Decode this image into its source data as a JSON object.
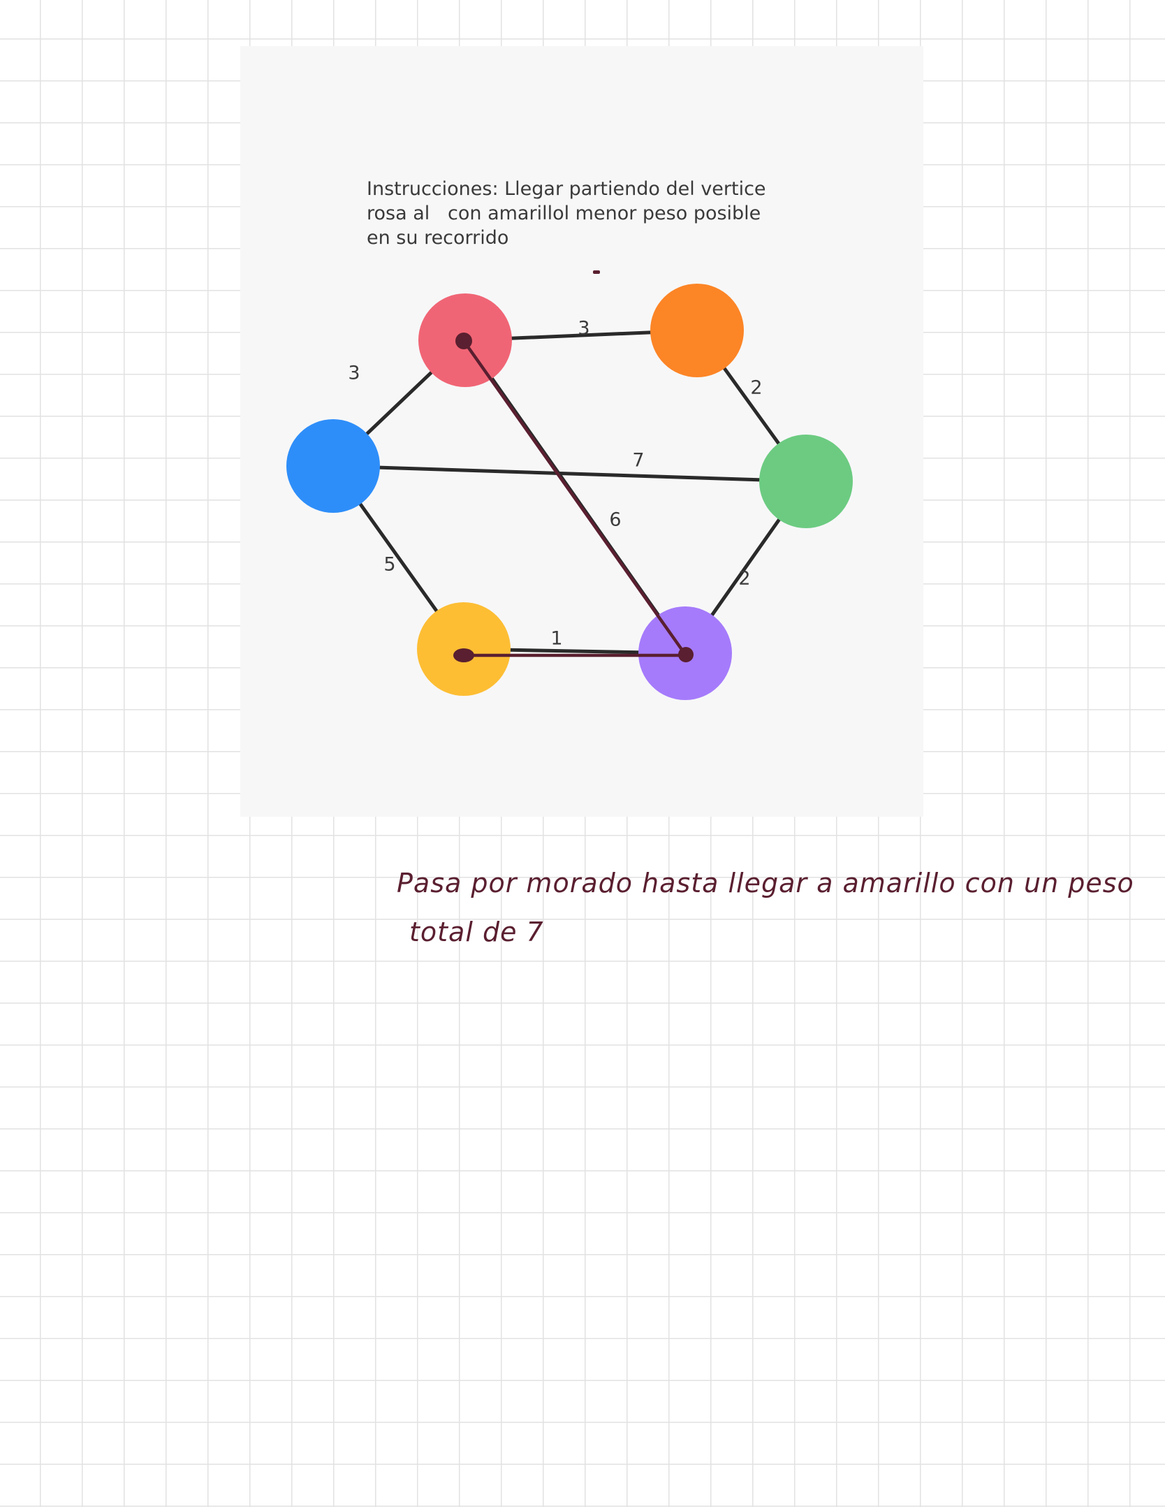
{
  "instructions": {
    "text": "Instrucciones: Llegar partiendo del vertice\nrosa al   con amarillol menor peso posible\nen su recorrido"
  },
  "graph": {
    "nodes": [
      {
        "id": "rosa",
        "color": "#f06575"
      },
      {
        "id": "naranja",
        "color": "#fc8526"
      },
      {
        "id": "azul",
        "color": "#2e8ef9"
      },
      {
        "id": "verde",
        "color": "#6ccb81"
      },
      {
        "id": "amarillo",
        "color": "#fdbe34"
      },
      {
        "id": "morado",
        "color": "#a57bfb"
      }
    ],
    "edges": [
      {
        "from": "rosa",
        "to": "naranja",
        "weight": "3"
      },
      {
        "from": "rosa",
        "to": "azul",
        "weight": "3"
      },
      {
        "from": "naranja",
        "to": "verde",
        "weight": "2"
      },
      {
        "from": "azul",
        "to": "verde",
        "weight": "7"
      },
      {
        "from": "rosa",
        "to": "morado",
        "weight": "6"
      },
      {
        "from": "azul",
        "to": "amarillo",
        "weight": "5"
      },
      {
        "from": "verde",
        "to": "morado",
        "weight": "2"
      },
      {
        "from": "amarillo",
        "to": "morado",
        "weight": "1"
      }
    ],
    "edge_color": "#2a2a2a",
    "drawn_path": [
      "rosa",
      "morado",
      "amarillo"
    ],
    "drawn_path_color": "#5a1f30"
  },
  "handwritten_note": {
    "line1": "Pasa por morado hasta llegar a amarillo con un peso",
    "line2": "total de 7"
  }
}
